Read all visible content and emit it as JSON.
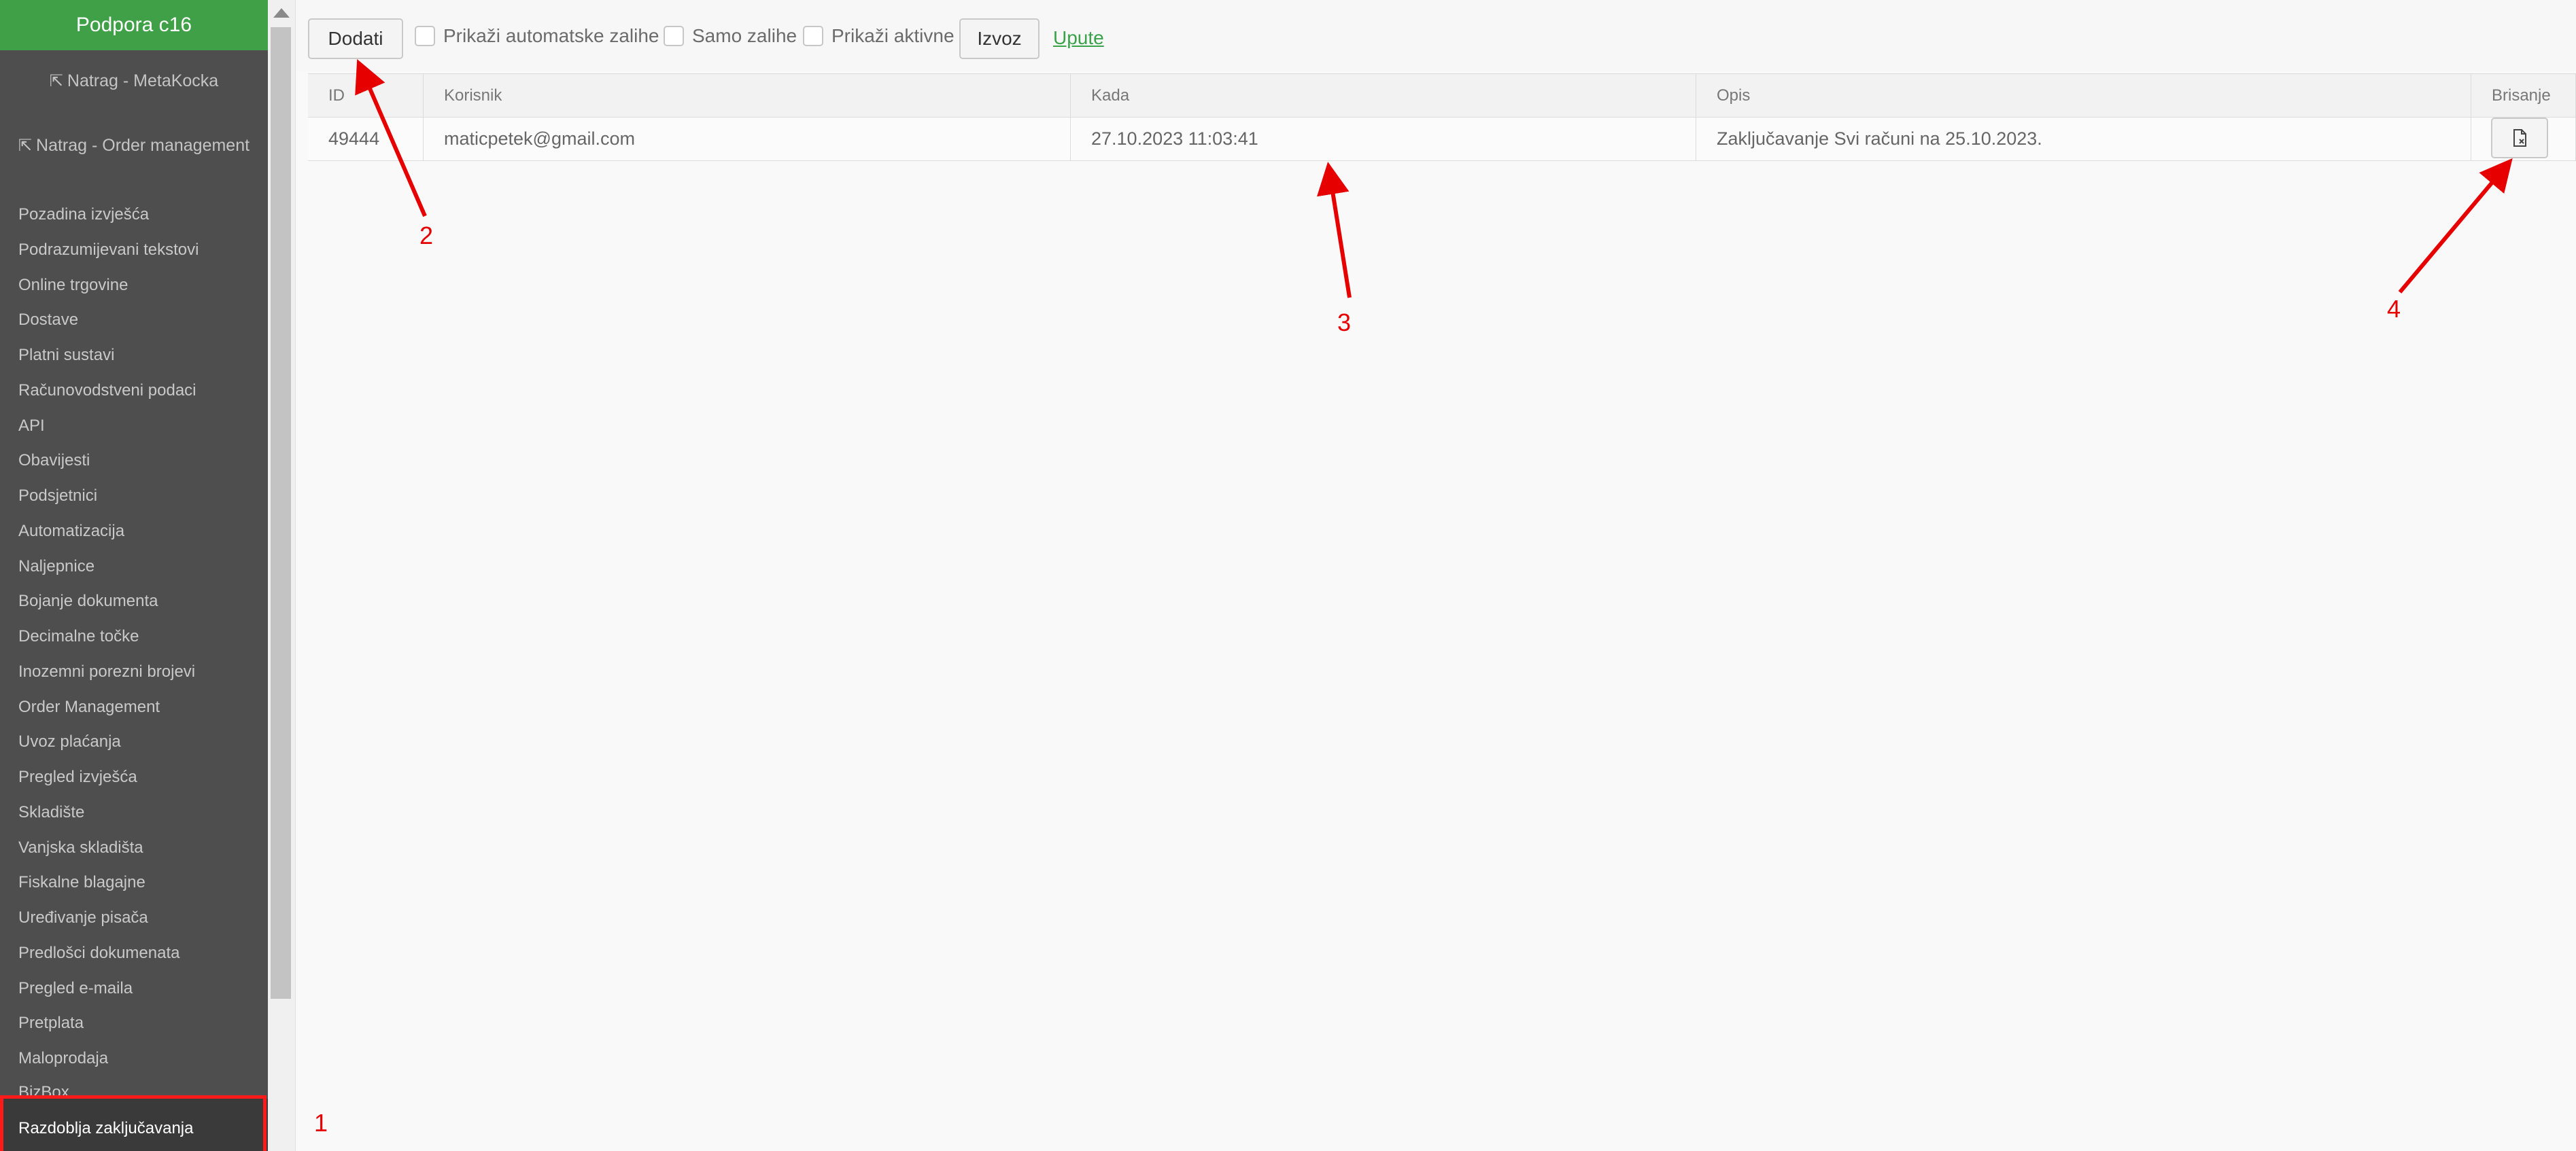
{
  "sidebar": {
    "header": "Podpora c16",
    "back_links": [
      "Natrag - MetaKocka",
      "Natrag - Order management"
    ],
    "items": [
      "Pozadina izvješća",
      "Podrazumijevani tekstovi",
      "Online trgovine",
      "Dostave",
      "Platni sustavi",
      "Računovodstveni podaci",
      "API",
      "Obavijesti",
      "Podsjetnici",
      "Automatizacija",
      "Naljepnice",
      "Bojanje dokumenta",
      "Decimalne točke",
      "Inozemni porezni brojevi",
      "Order Management",
      "Uvoz plaćanja",
      "Pregled izvješća",
      "Skladište",
      "Vanjska skladišta",
      "Fiskalne blagajne",
      "Uređivanje pisača",
      "Predlošci dokumenata",
      "Pregled e-maila",
      "Pretplata",
      "Maloprodaja",
      "BizBox"
    ],
    "active_item": "Razdoblja zaključavanja"
  },
  "toolbar": {
    "add_label": "Dodati",
    "checkboxes": [
      "Prikaži automatske zalihe",
      "Samo zalihe",
      "Prikaži aktivne"
    ],
    "export_label": "Izvoz",
    "help_link": "Upute"
  },
  "table": {
    "columns": [
      "ID",
      "Korisnik",
      "Kada",
      "Opis",
      "Brisanje"
    ],
    "rows": [
      {
        "id": "49444",
        "user": "maticpetek@gmail.com",
        "when": "27.10.2023 11:03:41",
        "description": "Zaključavanje Svi računi na 25.10.2023."
      }
    ]
  },
  "annotations": [
    "1",
    "2",
    "3",
    "4"
  ],
  "colors": {
    "accent": "#3fa047",
    "sidebar_bg": "#4e4e4e",
    "annotation": "#e60000"
  },
  "icons": {
    "back": "sign-out-icon",
    "delete": "file-delete-icon"
  }
}
